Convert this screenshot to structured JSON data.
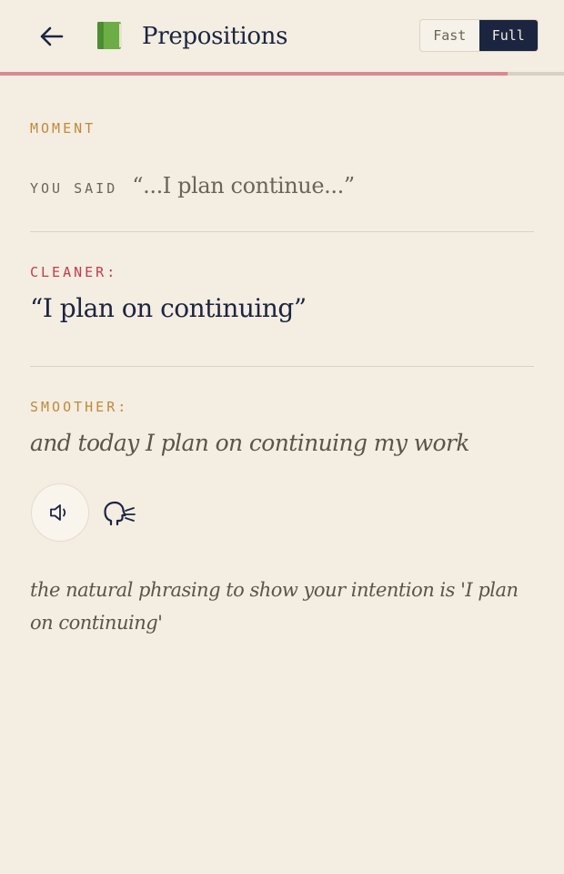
{
  "header": {
    "title": "Prepositions",
    "book_icon": "green-book-icon",
    "back_icon": "arrow-left-icon",
    "modes": [
      {
        "label": "Fast",
        "active": false
      },
      {
        "label": "Full",
        "active": true
      }
    ],
    "progress": 0.9
  },
  "moment": {
    "label": "MOMENT",
    "you_said_label": "YOU SAID",
    "you_said_text": "“...I plan continue...”"
  },
  "cleaner": {
    "label": "CLEANER:",
    "text": "“I plan on continuing”"
  },
  "smoother": {
    "label": "SMOOTHER:",
    "text": "and today I plan on continuing my work",
    "speaker_icon": "speaker-icon",
    "speak_icon": "speaking-head-icon"
  },
  "explanation": "the natural phrasing to show your intention is 'I plan on continuing'",
  "colors": {
    "background": "#f4ede2",
    "navy": "#1b2540",
    "gold": "#c08a38",
    "red": "#c23b4b",
    "progress": "#d98a8e"
  }
}
